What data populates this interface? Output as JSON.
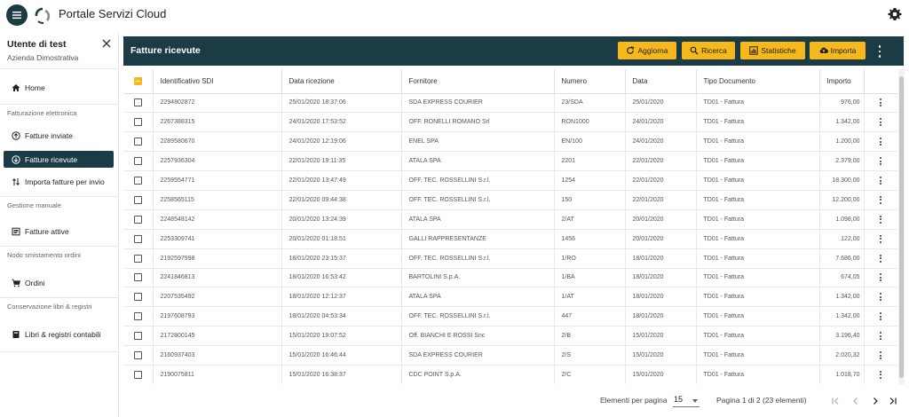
{
  "app": {
    "title": "Portale Servizi Cloud"
  },
  "sidebar": {
    "user_name": "Utente di test",
    "company": "Azienda Dimostrativa",
    "home": "Home",
    "section_fe": "Fatturazione elettronica",
    "fatture_inviate": "Fatture inviate",
    "fatture_ricevute": "Fatture ricevute",
    "importa_fatture": "Importa fatture per invio",
    "section_gestione": "Gestione manuale",
    "fatture_attive": "Fatture attive",
    "section_nodo": "Nodo smistamento ordini",
    "ordini": "Ordini",
    "section_conservazione": "Conservazione libri & registri",
    "libri": "Libri & registri contabili"
  },
  "panel": {
    "title": "Fatture ricevute",
    "btn_aggiorna": "Aggiorna",
    "btn_ricerca": "Ricerca",
    "btn_statistiche": "Statistiche",
    "btn_importa": "Importa"
  },
  "colors": {
    "primary": "#1b3b45",
    "accent": "#f6b81a"
  },
  "table": {
    "headers": {
      "id": "Identificativo SDI",
      "data_ricezione": "Data ricezione",
      "fornitore": "Fornitore",
      "numero": "Numero",
      "data": "Data",
      "tipo": "Tipo Documento",
      "importo": "Importo"
    },
    "rows": [
      {
        "id": "2294802872",
        "ricezione": "25/01/2020 18:37:06",
        "fornitore": "SDA EXPRESS COURIER",
        "numero": "23/SDA",
        "data": "25/01/2020",
        "tipo": "TD01 - Fattura",
        "importo": "976,00"
      },
      {
        "id": "2267388315",
        "ricezione": "24/01/2020 17:53:52",
        "fornitore": "OFF. RONELLI ROMANO Srl",
        "numero": "RON1000",
        "data": "24/01/2020",
        "tipo": "TD01 - Fattura",
        "importo": "1.342,00"
      },
      {
        "id": "2289580670",
        "ricezione": "24/01/2020 12:19:06",
        "fornitore": "ENEL SPA",
        "numero": "EN/100",
        "data": "24/01/2020",
        "tipo": "TD01 - Fattura",
        "importo": "1.200,00"
      },
      {
        "id": "2257936304",
        "ricezione": "22/01/2020 19:11:35",
        "fornitore": "ATALA SPA",
        "numero": "2201",
        "data": "22/01/2020",
        "tipo": "TD01 - Fattura",
        "importo": "2.379,00"
      },
      {
        "id": "2259554771",
        "ricezione": "22/01/2020 13:47:49",
        "fornitore": "OFF. TEC. ROSSELLINI S.r.l.",
        "numero": "1254",
        "data": "22/01/2020",
        "tipo": "TD01 - Fattura",
        "importo": "18.300,00"
      },
      {
        "id": "2258565115",
        "ricezione": "22/01/2020 09:44:38",
        "fornitore": "OFF. TEC. ROSSELLINI S.r.l.",
        "numero": "150",
        "data": "22/01/2020",
        "tipo": "TD01 - Fattura",
        "importo": "12.200,00"
      },
      {
        "id": "2248548142",
        "ricezione": "20/01/2020 13:24:39",
        "fornitore": "ATALA SPA",
        "numero": "2/AT",
        "data": "20/01/2020",
        "tipo": "TD01 - Fattura",
        "importo": "1.098,00"
      },
      {
        "id": "2253309741",
        "ricezione": "20/01/2020 01:18:51",
        "fornitore": "GALLI RAPPRESENTANZE",
        "numero": "1456",
        "data": "20/01/2020",
        "tipo": "TD01 - Fattura",
        "importo": "122,00"
      },
      {
        "id": "2192597998",
        "ricezione": "18/01/2020 23:15:37",
        "fornitore": "OFF. TEC. ROSSELLINI S.r.l.",
        "numero": "1/RO",
        "data": "18/01/2020",
        "tipo": "TD01 - Fattura",
        "importo": "7.686,00"
      },
      {
        "id": "2241846813",
        "ricezione": "18/01/2020 16:53:42",
        "fornitore": "BARTOLINI S.p.A.",
        "numero": "1/BA",
        "data": "18/01/2020",
        "tipo": "TD01 - Fattura",
        "importo": "674,05"
      },
      {
        "id": "2207535492",
        "ricezione": "18/01/2020 12:12:37",
        "fornitore": "ATALA SPA",
        "numero": "1/AT",
        "data": "18/01/2020",
        "tipo": "TD01 - Fattura",
        "importo": "1.342,00"
      },
      {
        "id": "2197608793",
        "ricezione": "18/01/2020 04:53:34",
        "fornitore": "OFF. TEC. ROSSELLINI S.r.l.",
        "numero": "447",
        "data": "18/01/2020",
        "tipo": "TD01 - Fattura",
        "importo": "1.342,00"
      },
      {
        "id": "2172800145",
        "ricezione": "15/01/2020 19:07:52",
        "fornitore": "Off. BIANCHI E ROSSI Snc",
        "numero": "2/B",
        "data": "15/01/2020",
        "tipo": "TD01 - Fattura",
        "importo": "3.196,40"
      },
      {
        "id": "2160937403",
        "ricezione": "15/01/2020 16:46:44",
        "fornitore": "SDA EXPRESS COURIER",
        "numero": "2/S",
        "data": "15/01/2020",
        "tipo": "TD01 - Fattura",
        "importo": "2.020,32"
      },
      {
        "id": "2190075811",
        "ricezione": "15/01/2020 16:38:37",
        "fornitore": "CDC POINT S.p.A.",
        "numero": "2/C",
        "data": "15/01/2020",
        "tipo": "TD01 - Fattura",
        "importo": "1.018,70"
      }
    ]
  },
  "paginator": {
    "items_label": "Elementi per pagina",
    "page_size": "15",
    "range_label": "Pagina 1 di 2 (23 elementi)"
  },
  "icons": {
    "menu": "menu-icon",
    "logo": "logo-icon",
    "settings": "gear-icon",
    "close": "close-icon",
    "home": "home-icon",
    "upload": "arrow-up-circle-icon",
    "download": "arrow-down-circle-icon",
    "import": "swap-arrows-icon",
    "document": "document-icon",
    "cart": "cart-icon",
    "book": "book-icon",
    "refresh": "refresh-icon",
    "search": "search-icon",
    "stats": "chart-icon",
    "cloud": "cloud-upload-icon",
    "kebab": "more-vert-icon",
    "first": "first-page-icon",
    "prev": "chevron-left-icon",
    "next": "chevron-right-icon",
    "last": "last-page-icon"
  }
}
